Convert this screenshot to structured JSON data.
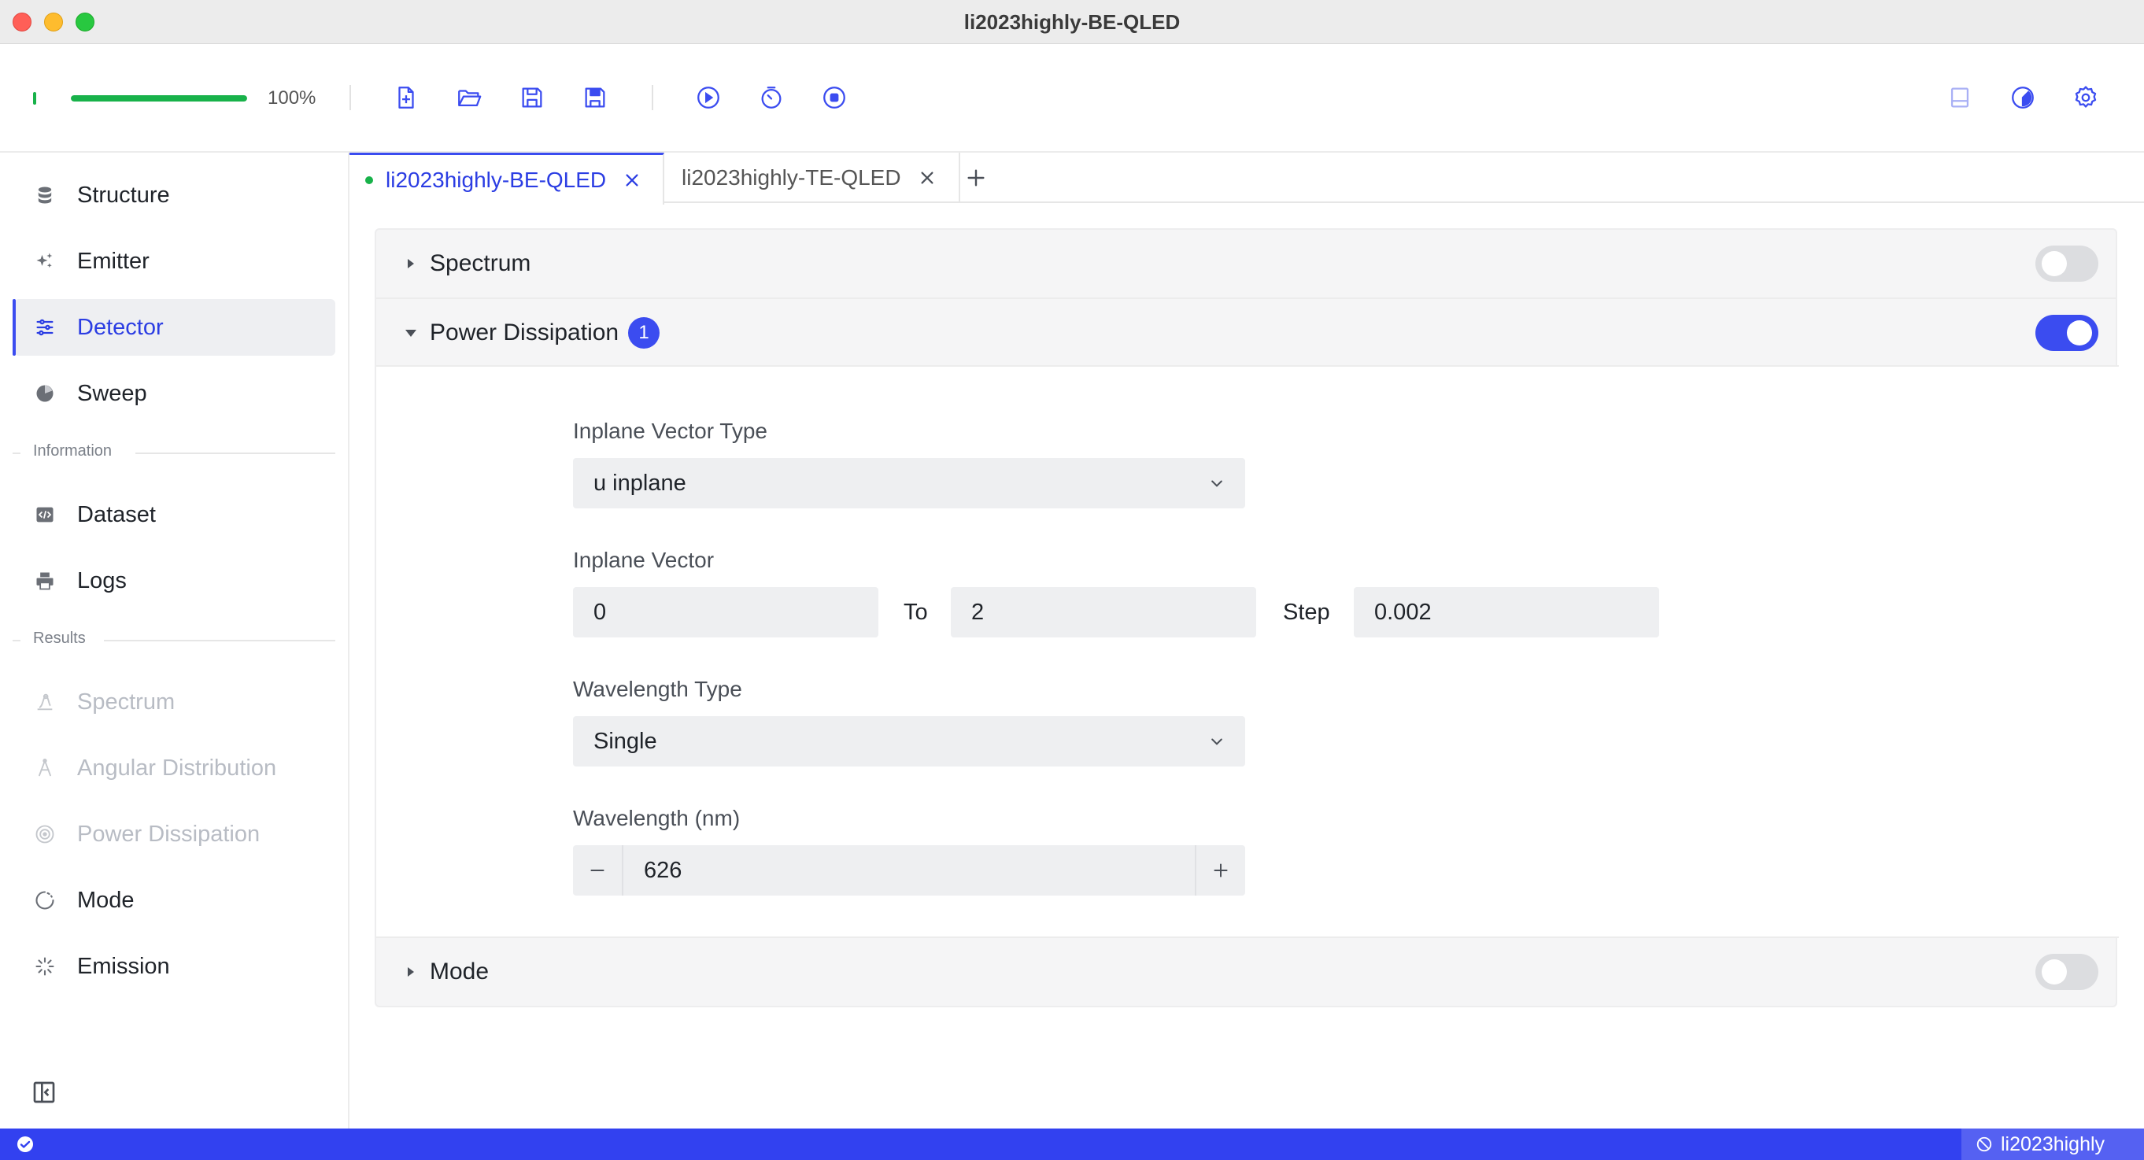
{
  "window": {
    "title": "li2023highly-BE-QLED"
  },
  "toolbar": {
    "progress_fraction": 1.0,
    "progress_label": "100%",
    "buttons": [
      {
        "icon": "new-file-icon"
      },
      {
        "icon": "open-folder-icon"
      },
      {
        "icon": "save-icon"
      },
      {
        "icon": "save-as-icon"
      },
      {
        "icon": "run-icon"
      },
      {
        "icon": "timer-icon"
      },
      {
        "icon": "stop-icon"
      },
      {
        "icon": "panel-icon"
      },
      {
        "icon": "theme-icon"
      },
      {
        "icon": "settings-icon"
      }
    ]
  },
  "sidebar": {
    "items": [
      {
        "label": "Structure",
        "icon": "database-icon"
      },
      {
        "label": "Emitter",
        "icon": "sparkle-icon"
      },
      {
        "label": "Detector",
        "icon": "sliders-icon",
        "active": true
      },
      {
        "label": "Sweep",
        "icon": "sweep-icon"
      }
    ],
    "groups": {
      "information": {
        "label": "Information",
        "items": [
          {
            "label": "Dataset",
            "icon": "code-icon"
          },
          {
            "label": "Logs",
            "icon": "printer-icon"
          }
        ]
      },
      "results": {
        "label": "Results",
        "items": [
          {
            "label": "Spectrum",
            "icon": "spectrum-icon",
            "disabled": true
          },
          {
            "label": "Angular Distribution",
            "icon": "angular-icon",
            "disabled": true
          },
          {
            "label": "Power Dissipation",
            "icon": "power-icon",
            "disabled": true
          },
          {
            "label": "Mode",
            "icon": "mode-icon"
          },
          {
            "label": "Emission",
            "icon": "emission-icon"
          }
        ]
      }
    }
  },
  "tabs": [
    {
      "label": "li2023highly-BE-QLED",
      "active": true
    },
    {
      "label": "li2023highly-TE-QLED",
      "active": false
    }
  ],
  "sections": {
    "spectrum": {
      "title": "Spectrum",
      "enabled": false
    },
    "power_dissipation": {
      "title": "Power Dissipation",
      "badge": "1",
      "enabled": true
    },
    "mode": {
      "title": "Mode",
      "enabled": false
    }
  },
  "form": {
    "inplane_vector_type": {
      "label": "Inplane Vector Type",
      "value": "u inplane"
    },
    "inplane_vector": {
      "label": "Inplane Vector",
      "from": "0",
      "to_label": "To",
      "to": "2",
      "step_label": "Step",
      "step": "0.002"
    },
    "wavelength_type": {
      "label": "Wavelength Type",
      "value": "Single"
    },
    "wavelength": {
      "label": "Wavelength (nm)",
      "value": "626"
    }
  },
  "statusbar": {
    "project": "li2023highly"
  },
  "colors": {
    "accent": "#3b4cf0",
    "success": "#18b24a",
    "status_bar": "#3241f0"
  }
}
